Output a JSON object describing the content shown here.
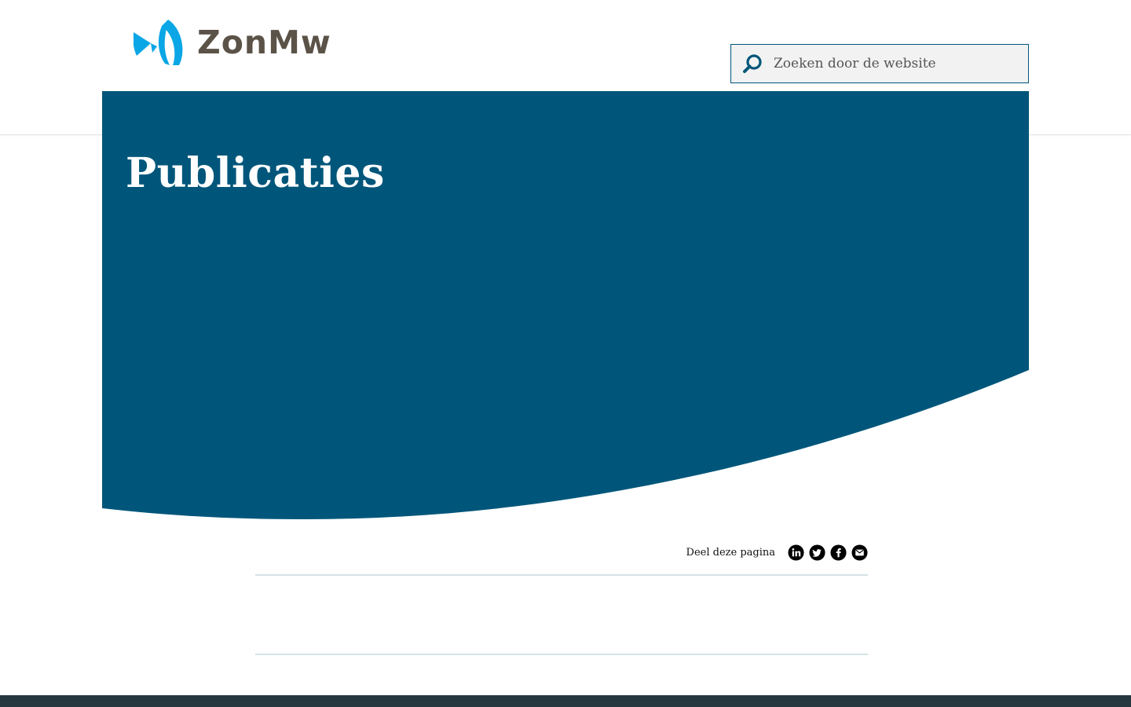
{
  "brand": {
    "logo_text": "ZonMw",
    "icon": "zonmw-logo-icon",
    "color_primary": "#00567a",
    "color_logo_blue": "#0aa6e6",
    "color_logo_text": "#5b5248"
  },
  "search": {
    "placeholder": "Zoeken door de website",
    "value": "",
    "icon": "search-icon"
  },
  "hero": {
    "title": "Publicaties",
    "background": "#00567a"
  },
  "share": {
    "label": "Deel deze pagina",
    "icons": [
      "linkedin-icon",
      "twitter-icon",
      "facebook-icon",
      "email-icon"
    ]
  },
  "footer": {
    "background": "#27383f"
  }
}
